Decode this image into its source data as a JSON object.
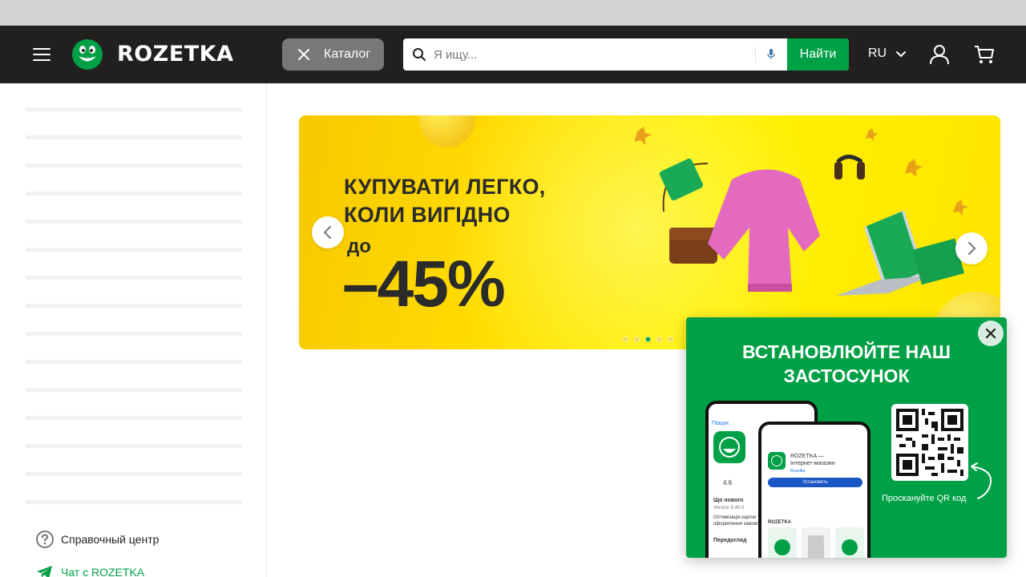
{
  "header": {
    "logo_text": "ROZETKA",
    "catalog_label": "Каталог",
    "search_placeholder": "Я ищу...",
    "search_button": "Найти",
    "language": "RU"
  },
  "sidebar": {
    "links": [
      {
        "label": "Справочный центр",
        "icon": "help-circle-icon"
      },
      {
        "label": "Чат с ROZETKA",
        "icon": "telegram-plane-icon"
      }
    ]
  },
  "banner": {
    "line1": "КУПУВАТИ ЛЕГКО,",
    "line2": "КОЛИ ВИГІДНО",
    "prefix": "до",
    "discount": "–45%",
    "slides_total": 5,
    "active_slide": 3
  },
  "app_popup": {
    "title": "ВСТАНОВЛЮЙТЕ НАШ ЗАСТОСУНОК",
    "qr_caption": "Проскануйте QR код",
    "phone_back": {
      "back": "Пошук",
      "rating": "4.6",
      "whats_new": "Що нового",
      "version": "Version 5.40.0",
      "desc": "Оптимізація картки то",
      "desc2": "оформлення замовле",
      "preview": "Передогляд"
    },
    "phone_front": {
      "app_name": "ROZETKA —",
      "app_name2": "Інтернет-магазин",
      "developer": "Rozetka",
      "install": "Установить",
      "brand": "ROZETKA"
    }
  },
  "colors": {
    "header_bg": "#221f1f",
    "brand_green": "#00a046",
    "catalog_bg": "#797878"
  }
}
